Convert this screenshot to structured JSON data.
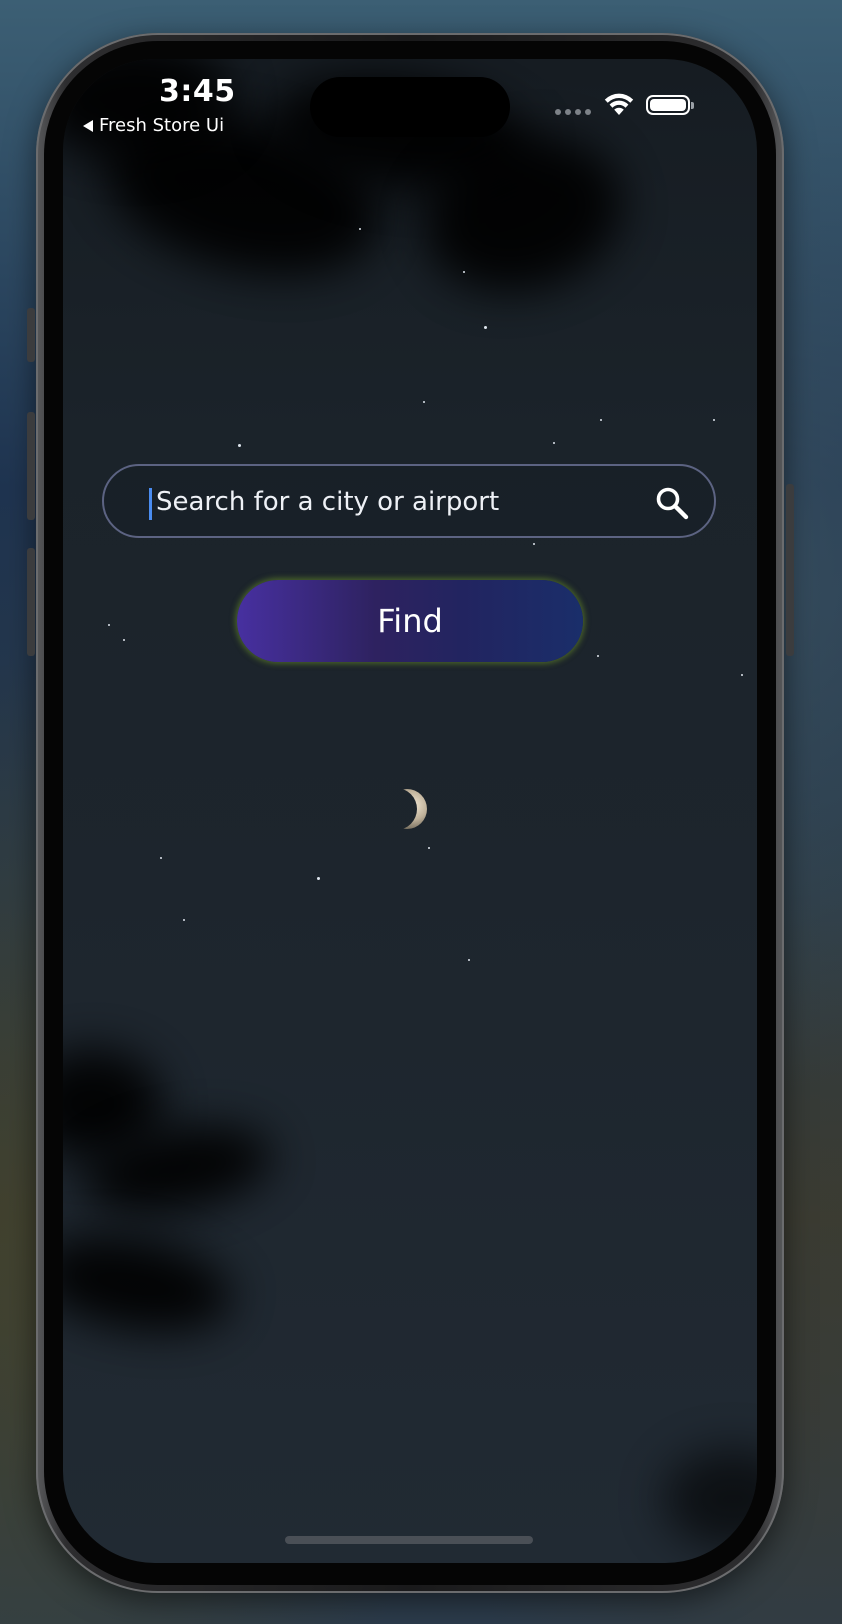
{
  "status_bar": {
    "time": "3:45",
    "back_app": "Fresh Store Ui",
    "icons": [
      "signal-icon",
      "wifi-icon",
      "battery-icon"
    ]
  },
  "search": {
    "placeholder": "Search for a city or airport",
    "value": "",
    "icon": "search-icon"
  },
  "find_button": {
    "label": "Find"
  },
  "colors": {
    "accent_caret": "#4a8cf0",
    "button_gradient_start": "#4730a0",
    "button_gradient_end": "#1a2e6a",
    "button_glow": "#6e9628",
    "search_border": "#5c6382",
    "background": "#1b232a"
  },
  "decorations": {
    "moon": "crescent-moon-icon",
    "background": "night-sky-with-stars"
  }
}
